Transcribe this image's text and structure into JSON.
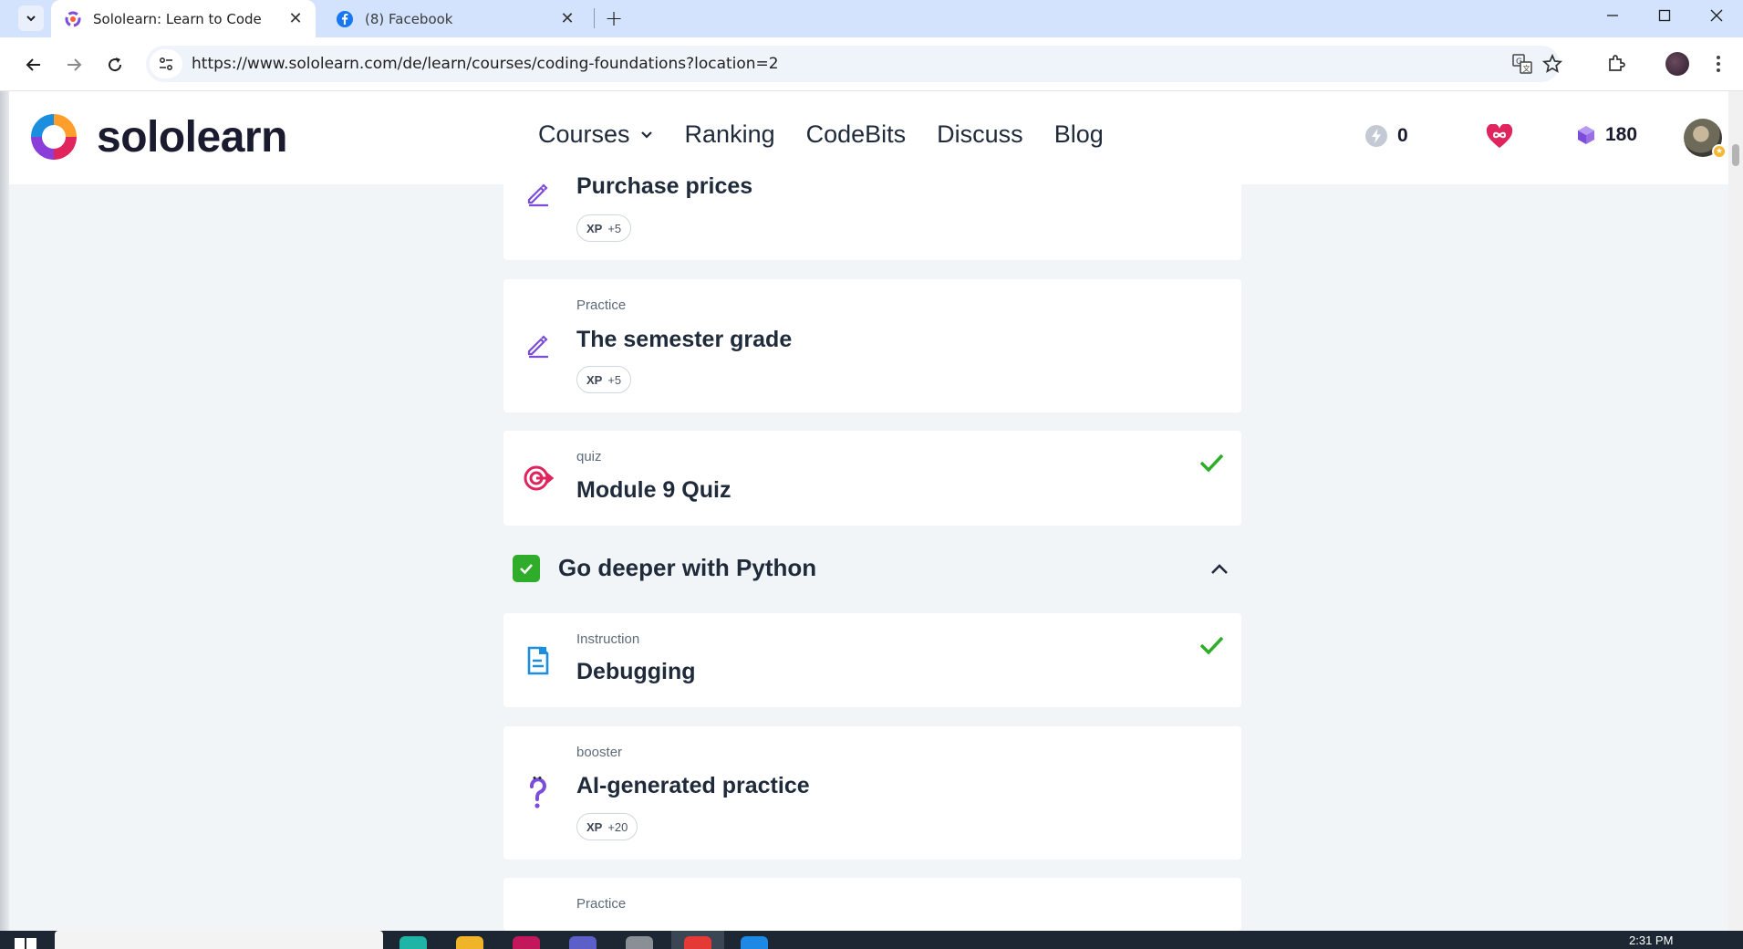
{
  "browser": {
    "tabs": [
      {
        "title": "Sololearn: Learn to Code",
        "active": true
      },
      {
        "title": "(8) Facebook",
        "active": false
      }
    ],
    "url": "https://www.sololearn.com/de/learn/courses/coding-foundations?location=2"
  },
  "site": {
    "logo_text": "sololearn",
    "nav": [
      {
        "label": "Courses"
      },
      {
        "label": "Ranking"
      },
      {
        "label": "CodeBits"
      },
      {
        "label": "Discuss"
      },
      {
        "label": "Blog"
      }
    ],
    "stats": {
      "streak": "0",
      "gems": "180"
    }
  },
  "lessons_top": [
    {
      "type": "",
      "title": "Purchase prices",
      "xp_label": "XP",
      "xp_value": "+5",
      "completed": false
    },
    {
      "type": "Practice",
      "title": "The semester grade",
      "xp_label": "XP",
      "xp_value": "+5",
      "completed": false
    },
    {
      "type": "quiz",
      "title": "Module 9 Quiz",
      "completed": true
    }
  ],
  "section": {
    "title": "Go deeper with Python",
    "completed": true,
    "expanded": true
  },
  "lessons_section": [
    {
      "type": "Instruction",
      "title": "Debugging",
      "completed": true
    },
    {
      "type": "booster",
      "title": "AI-generated practice",
      "xp_label": "XP",
      "xp_value": "+20",
      "completed": false
    },
    {
      "type": "Practice",
      "title": "",
      "completed": false
    }
  ],
  "taskbar": {
    "time": "2:31 PM"
  },
  "colors": {
    "brand_purple": "#7c4ddb",
    "quiz_pink": "#e0245e",
    "check_green": "#2fac29",
    "instruction_blue": "#1c8ee0",
    "page_bg": "#f2f5f7"
  },
  "icons": {
    "practice": "pencil-edit-icon",
    "quiz": "target-icon",
    "instruction": "document-icon",
    "booster": "question-mark-icon",
    "completed": "checkmark-icon"
  }
}
